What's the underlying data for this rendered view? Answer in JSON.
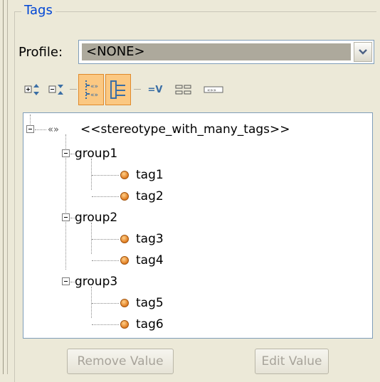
{
  "panel": {
    "title": "Tags"
  },
  "profile": {
    "label": "Profile:",
    "value": "<NONE>"
  },
  "toolbar": {
    "buttons": [
      {
        "icon": "expand-all-icon"
      },
      {
        "icon": "collapse-all-icon"
      },
      {
        "icon": "show-stereotypes-icon",
        "active": true
      },
      {
        "icon": "group-view-icon",
        "active": true
      },
      {
        "icon": "show-values-icon"
      },
      {
        "icon": "list-view-icon"
      },
      {
        "icon": "compact-view-icon"
      }
    ],
    "value_toggle_text": "=V"
  },
  "tree": {
    "root": {
      "label": "<<stereotype_with_many_tags>>",
      "prefix": "«»"
    },
    "groups": [
      {
        "label": "group1",
        "tags": [
          "tag1",
          "tag2"
        ]
      },
      {
        "label": "group2",
        "tags": [
          "tag3",
          "tag4"
        ]
      },
      {
        "label": "group3",
        "tags": [
          "tag5",
          "tag6"
        ]
      }
    ]
  },
  "buttons": {
    "remove": "Remove Value",
    "edit": "Edit Value"
  },
  "colors": {
    "background": "#ece9d8",
    "legend": "#0046d5",
    "active_toggle": "#fbc882",
    "tag_dot": "#e07b1f"
  }
}
